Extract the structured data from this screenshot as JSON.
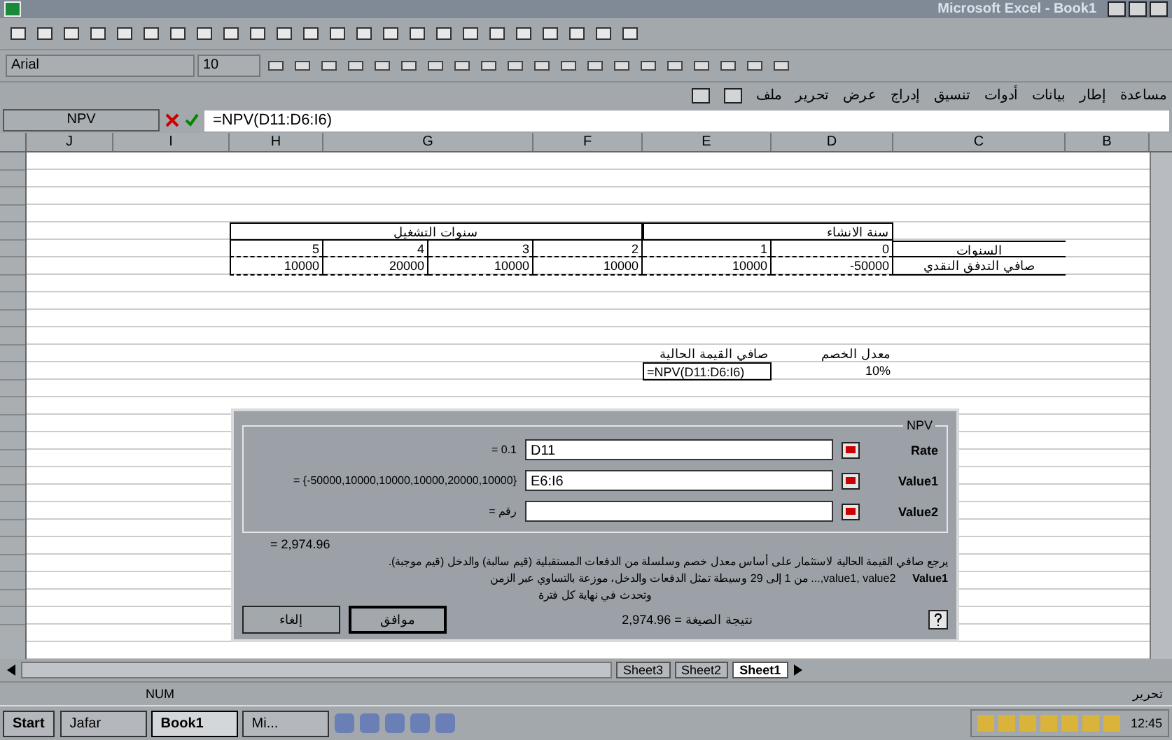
{
  "window": {
    "title": "Microsoft Excel - Book1"
  },
  "formatting": {
    "font": "Arial",
    "size": "10"
  },
  "menu": [
    "مساعدة",
    "إطار",
    "بيانات",
    "أدوات",
    "تنسيق",
    "إدراج",
    "عرض",
    "تحرير",
    "ملف"
  ],
  "formula_bar": {
    "name_box": "NPV",
    "formula": "=NPV(D11:D6:I6)"
  },
  "columns": [
    "B",
    "C",
    "D",
    "E",
    "F",
    "G",
    "H",
    "I",
    "J"
  ],
  "table": {
    "header_operation": "سنوات التشغيل",
    "header_build": "سنة الانشاء",
    "row_label_years": "السنوات",
    "row_label_flow": "صافي التدفق النقدي",
    "years": [
      "0",
      "1",
      "2",
      "3",
      "4",
      "5"
    ],
    "values": [
      "-50000",
      "10000",
      "10000",
      "10000",
      "20000",
      "10000"
    ]
  },
  "npv_block": {
    "npv_label": "صافي القيمة الحالية",
    "npv_value": "=NPV(D11:D6:I6)",
    "rate_label": "معدل الخصم",
    "rate_value": "10%"
  },
  "dialog": {
    "group": "NPV",
    "args": [
      {
        "label": "Rate",
        "value": "D11",
        "result": "= 0.1"
      },
      {
        "label": "Value1",
        "value": "E6:I6",
        "result": "= {-50000,10000,10000,10000,20000,10000}"
      },
      {
        "label": "Value2",
        "result": "= رقم"
      }
    ],
    "result_line": "= 2,974.96",
    "description": "يرجع صافي القيمة الحالية لاستثمار على أساس معدل خصم وسلسلة من الدفعات المستقبلية (قيم سالبة) والدخل (قيم موجبة).",
    "arg_name": "Value1",
    "arg_help": "value1, value2,... من 1 إلى 29 وسيطة تمثل الدفعات والدخل، موزعة بالتساوي عبر الزمن",
    "arg_help2": "وتحدث في نهاية كل فترة",
    "formula_result": "نتيجة الصيغة = 2,974.96",
    "ok": "موافق",
    "cancel": "إلغاء"
  },
  "sheet_tabs": [
    {
      "label": "Sheet1",
      "selected": true
    },
    {
      "label": "Sheet2",
      "selected": false
    },
    {
      "label": "Sheet3",
      "selected": false
    }
  ],
  "status": {
    "mode": "تحرير",
    "num": "NUM"
  },
  "taskbar": {
    "start": "Start",
    "tasks": [
      {
        "label": "Mi...",
        "selected": false
      },
      {
        "label": "Book1",
        "selected": true
      },
      {
        "label": "Jafar",
        "selected": false
      }
    ],
    "clock": "12:45"
  }
}
